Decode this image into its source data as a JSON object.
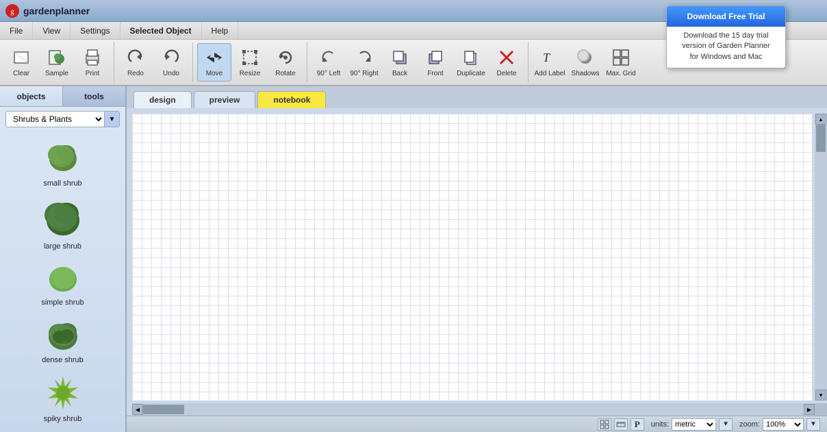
{
  "app": {
    "title": "gardenplanner",
    "logo_char": "g"
  },
  "trial_popup": {
    "btn_label": "Download Free Trial",
    "line1": "Download the 15 day trial",
    "line2": "version of Garden Planner",
    "line3": "for Windows and Mac"
  },
  "menu": {
    "items": [
      "File",
      "View",
      "Settings",
      "Selected Object",
      "Help"
    ]
  },
  "toolbar": {
    "groups": [
      {
        "buttons": [
          {
            "id": "clear",
            "label": "Clear"
          },
          {
            "id": "sample",
            "label": "Sample"
          },
          {
            "id": "print",
            "label": "Print"
          }
        ]
      },
      {
        "buttons": [
          {
            "id": "redo",
            "label": "Redo"
          },
          {
            "id": "undo",
            "label": "Undo"
          }
        ]
      },
      {
        "buttons": [
          {
            "id": "move",
            "label": "Move"
          },
          {
            "id": "resize",
            "label": "Resize"
          },
          {
            "id": "rotate",
            "label": "Rotate"
          }
        ]
      },
      {
        "buttons": [
          {
            "id": "90left",
            "label": "90° Left"
          },
          {
            "id": "90right",
            "label": "90° Right"
          },
          {
            "id": "back",
            "label": "Back"
          },
          {
            "id": "front",
            "label": "Front"
          },
          {
            "id": "duplicate",
            "label": "Duplicate"
          },
          {
            "id": "delete",
            "label": "Delete"
          }
        ]
      },
      {
        "buttons": [
          {
            "id": "addlabel",
            "label": "Add Label"
          },
          {
            "id": "shadows",
            "label": "Shadows"
          },
          {
            "id": "maxgrid",
            "label": "Max. Grid"
          }
        ]
      }
    ]
  },
  "left_panel": {
    "tabs": [
      "objects",
      "tools"
    ],
    "active_tab": "objects",
    "category": "Shrubs & Plants",
    "objects": [
      {
        "id": "small-shrub",
        "label": "small shrub",
        "shape": "small"
      },
      {
        "id": "large-shrub",
        "label": "large shrub",
        "shape": "large"
      },
      {
        "id": "simple-shrub",
        "label": "simple shrub",
        "shape": "simple"
      },
      {
        "id": "dense-shrub",
        "label": "dense shrub",
        "shape": "dense"
      },
      {
        "id": "spiky-shrub",
        "label": "spiky shrub",
        "shape": "spiky"
      }
    ]
  },
  "content_tabs": {
    "tabs": [
      {
        "id": "design",
        "label": "design",
        "active": true
      },
      {
        "id": "preview",
        "label": "preview",
        "active": false
      },
      {
        "id": "notebook",
        "label": "notebook",
        "active": false
      }
    ]
  },
  "statusbar": {
    "units_label": "units:",
    "units_value": "metric",
    "zoom_label": "zoom:",
    "zoom_value": "100%"
  }
}
